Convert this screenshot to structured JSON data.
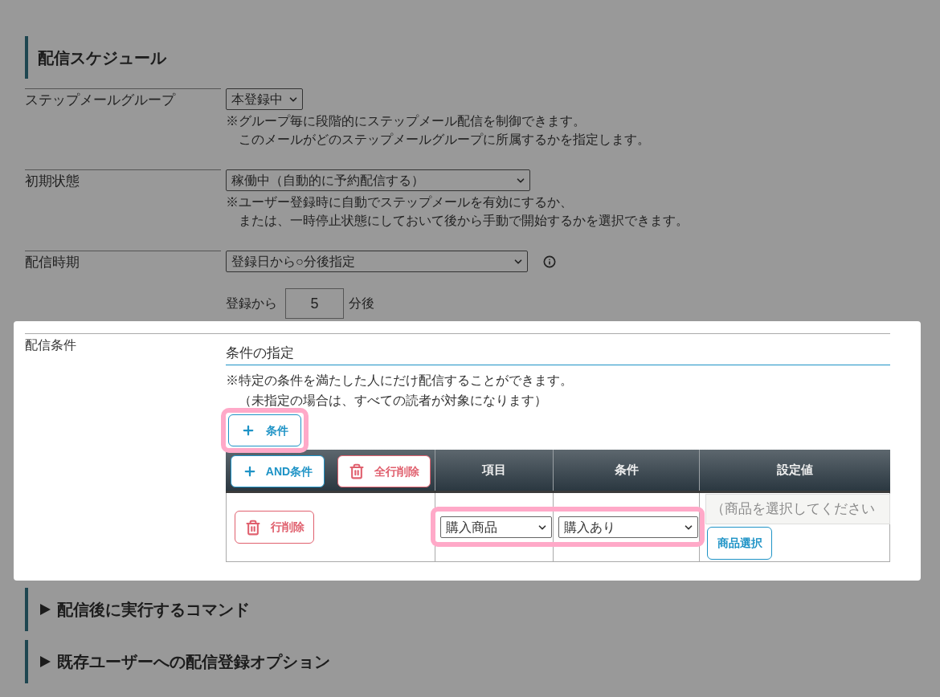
{
  "schedule": {
    "title": "配信スケジュール",
    "rows": [
      {
        "kind": "select",
        "label": "ステップメールグループ",
        "value": "本登録中",
        "note": [
          "※グループ毎に段階的にステップメール配信を制御できます。",
          "このメールがどのステップメールグループに所属するかを指定します。"
        ]
      },
      {
        "kind": "select",
        "label": "初期状態",
        "value": "稼働中（自動的に予約配信する）",
        "note": [
          "※ユーザー登録時に自動でステップメールを有効にするか、",
          "または、一時停止状態にしておいて後から手動で開始するかを選択できます。"
        ]
      },
      {
        "kind": "timing",
        "label": "配信時期",
        "value": "登録日から○分後指定",
        "sub_field": {
          "prefix": "登録から",
          "value": "5",
          "suffix": "分後"
        }
      }
    ]
  },
  "conditions": {
    "label": "配信条件",
    "heading": "条件の指定",
    "note": [
      "※特定の条件を満たした人にだけ配信することができます。",
      "（未指定の場合は、すべての読者が対象になります）"
    ],
    "add_button": {
      "label": "条件",
      "highlighted": true
    },
    "table": {
      "header_buttons": [
        {
          "kind": "add",
          "label": "AND条件"
        },
        {
          "kind": "delete",
          "label": "全行削除"
        }
      ],
      "columns": [
        "項目",
        "条件",
        "設定値"
      ],
      "rows": [
        {
          "delete_button": "行削除",
          "item": "購入商品",
          "condition": "購入あり",
          "value_placeholder": "（商品を選択してください",
          "select_button": "商品選択",
          "highlighted": true
        }
      ]
    }
  },
  "collapsed_sections": [
    {
      "title": "配信後に実行するコマンド",
      "expanded": false
    },
    {
      "title": "既存ユーザーへの配信登録オプション",
      "expanded": false
    }
  ]
}
